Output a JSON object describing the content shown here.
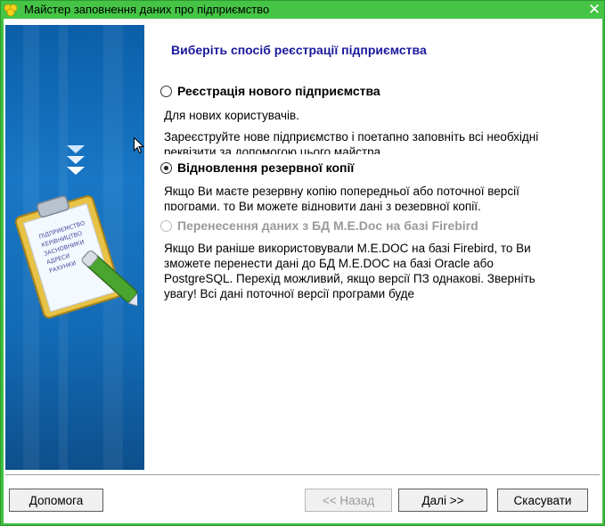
{
  "window": {
    "title": "Майстер заповнення даних про підприємство",
    "close_glyph": "✕",
    "accent": "#45c445"
  },
  "content": {
    "heading": "Виберіть спосіб реєстрації підприємства",
    "options": [
      {
        "label": "Реєстрація нового підприємства",
        "checked": false,
        "enabled": true,
        "description": [
          "Для нових користувачів.",
          "Зареєструйте нове підприємство і поетапно заповніть всі необхідні реквізити за допомогою цього майстра."
        ]
      },
      {
        "label": "Відновлення резервної копії",
        "checked": true,
        "enabled": true,
        "description": [
          "Якщо Ви маєте резервну копію попередньої або поточної версії програми, то Ви можете відновити дані з резервної копії."
        ]
      },
      {
        "label": "Перенесення даних з БД M.E.Doc на базі Firebird",
        "checked": false,
        "enabled": false,
        "description": [
          "Якщо Ви раніше використовували M.E.DOC на базі Firebird, то Ви зможете перенести дані до БД M.E.DOC на базі Oracle або PostgreSQL. Перехід можливий, якщо версії ПЗ однакові. Зверніть увагу! Всі дані поточної версії програми буде"
        ]
      }
    ]
  },
  "sidebar": {
    "clipboard_lines": [
      "ПІДПРИЄМСТВО",
      "КЕРІВНИЦТВО",
      "ЗАСНОВНИКИ",
      "АДРЕСИ",
      "РАХУНКИ"
    ],
    "icons": [
      "triple-chevron-down-icon",
      "clipboard-with-pen-icon"
    ]
  },
  "buttons": {
    "help": "Допомога",
    "back": "<< Назад",
    "next": "Далі >>",
    "cancel": "Скасувати"
  }
}
